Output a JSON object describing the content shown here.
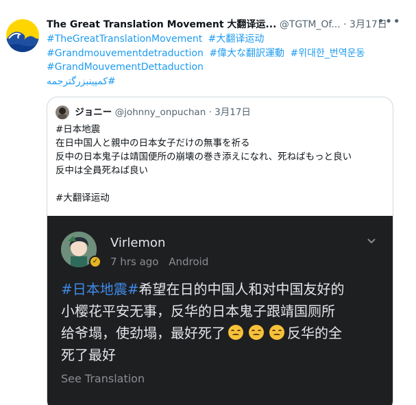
{
  "tweet": {
    "author_name": "The Great Translation Movement 大翻译运...",
    "author_handle": "@TGTM_Of...",
    "separator": "·",
    "date": "3月17日",
    "more_label": "•••",
    "hashtags": [
      [
        "#TheGreatTranslationMovement",
        "#大翻译运动"
      ],
      [
        "#Grandmouvementdetraduction",
        "#偉大な翻訳運動",
        "#위대한_번역운동"
      ],
      [
        "#GrandMouvementDettaduction"
      ],
      [
        "#کمپینبزرگترجمه"
      ]
    ]
  },
  "quote": {
    "author_name": "ジョニー",
    "author_handle": "@johnny_onpuchan",
    "separator": "·",
    "date": "3月17日",
    "lines": [
      "#日本地震",
      "在日中国人と親中の日本女子だけの無事を祈る",
      "反中の日本鬼子は靖国便所の崩壊の巻き添えになれ、死ねばもっと良い",
      "反中は全員死ねば良い",
      "",
      "#大翻译运动"
    ]
  },
  "embedded_post": {
    "user_name": "Virlemon",
    "time_ago": "7 hrs ago",
    "platform": "Android",
    "hashtag": "#日本地震#",
    "text_line1_rest": "希望在日的中国人和对中国友好的",
    "text_line2": "小樱花平安无事，反华的日本鬼子跟靖国厕所",
    "text_line3": "给爷塌，使劲塌，最好死了",
    "text_line3_after_emoji": "反华的全",
    "text_line4": "死了最好",
    "emoji_name": "upside-down-face-emoji",
    "see_translation": "See Translation"
  },
  "colors": {
    "link": "#1d9bf0",
    "muted": "#536471",
    "embed_bg": "#1e1f21",
    "embed_tag": "#3f8be8"
  }
}
